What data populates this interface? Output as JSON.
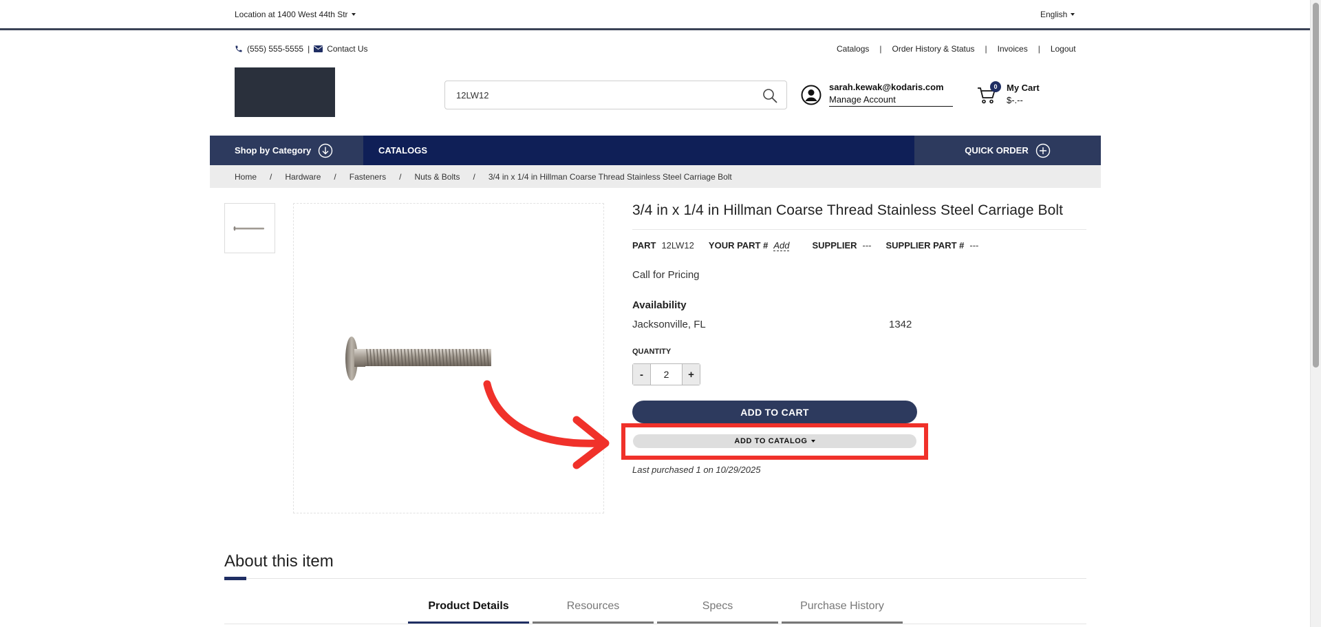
{
  "topbar": {
    "location": "Location at 1400 West 44th Str",
    "language": "English"
  },
  "header": {
    "phone": "(555) 555-5555",
    "separator": "|",
    "contact": "Contact Us",
    "links": [
      "Catalogs",
      "Order History & Status",
      "Invoices",
      "Logout"
    ],
    "link_separator": "|",
    "search_value": "12LW12",
    "account": {
      "email": "sarah.kewak@kodaris.com",
      "manage": "Manage Account"
    },
    "cart": {
      "count": "0",
      "title": "My Cart",
      "amount": "$-.--"
    }
  },
  "nav": {
    "shop_by_category": "Shop by Category",
    "catalogs": "CATALOGS",
    "quick_order": "QUICK ORDER"
  },
  "breadcrumb": {
    "separator": "/",
    "items": [
      "Home",
      "Hardware",
      "Fasteners",
      "Nuts & Bolts",
      "3/4 in x 1/4 in Hillman Coarse Thread Stainless Steel Carriage Bolt"
    ]
  },
  "product": {
    "title": "3/4 in x 1/4 in Hillman Coarse Thread Stainless Steel Carriage Bolt",
    "part_label": "PART",
    "part_value": "12LW12",
    "your_part_label": "YOUR PART #",
    "your_part_value": "Add",
    "supplier_label": "SUPPLIER",
    "supplier_value": "---",
    "supplier_part_label": "SUPPLIER PART #",
    "supplier_part_value": "---",
    "pricing": "Call for Pricing",
    "availability_heading": "Availability",
    "availability_location": "Jacksonville, FL",
    "availability_qty": "1342",
    "quantity_heading": "QUANTITY",
    "quantity_value": "2",
    "minus": "-",
    "plus": "+",
    "add_to_cart": "ADD TO CART",
    "add_to_catalog": "ADD TO CATALOG",
    "last_purchased": "Last purchased 1 on 10/29/2025"
  },
  "about": {
    "heading": "About this item",
    "tabs": [
      "Product Details",
      "Resources",
      "Specs",
      "Purchase History"
    ]
  },
  "colors": {
    "nav": "#0f1f57",
    "nav_accent": "#2d3a5e",
    "highlight": "#f0312a"
  }
}
